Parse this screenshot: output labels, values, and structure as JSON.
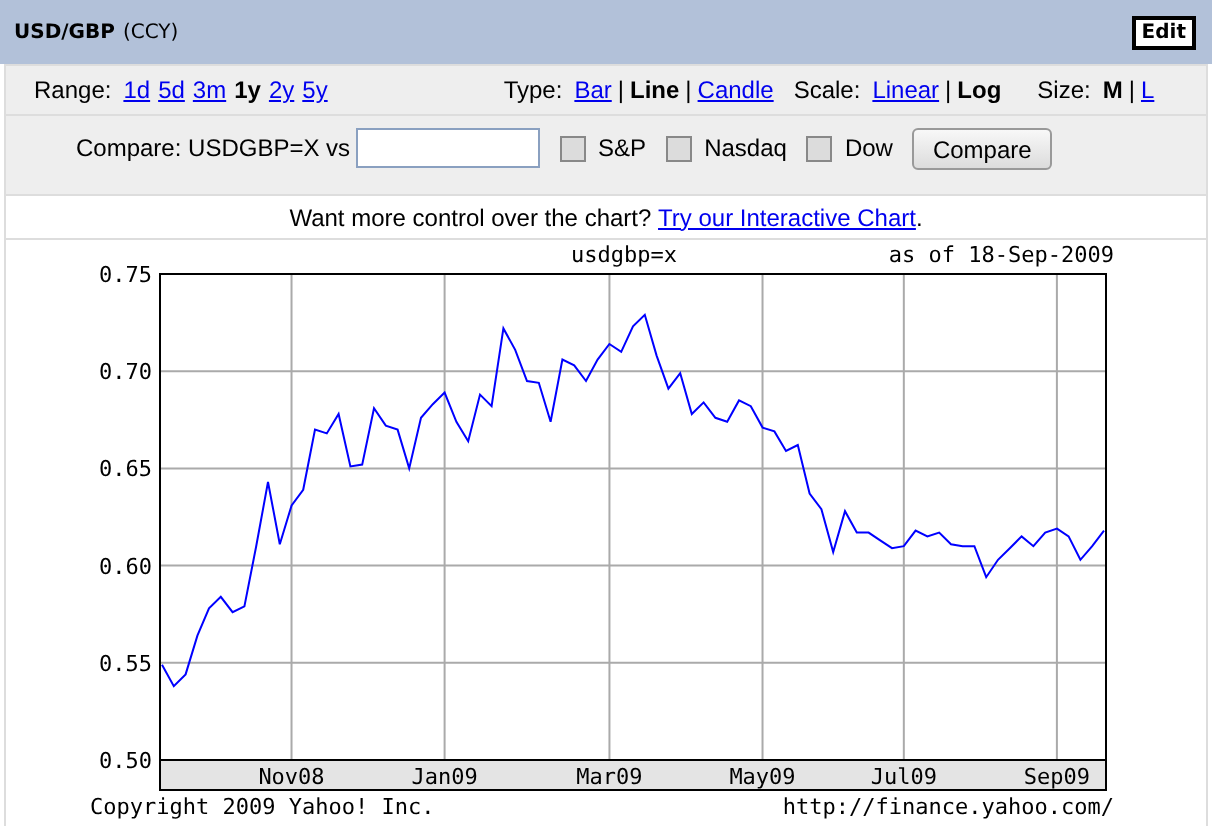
{
  "header": {
    "symbol": "USD/GBP",
    "type": "(CCY)",
    "edit_button": "Edit"
  },
  "range": {
    "label": "Range:",
    "options": [
      {
        "label": "1d",
        "selected": false
      },
      {
        "label": "5d",
        "selected": false
      },
      {
        "label": "3m",
        "selected": false
      },
      {
        "label": "1y",
        "selected": true
      },
      {
        "label": "2y",
        "selected": false
      },
      {
        "label": "5y",
        "selected": false
      }
    ]
  },
  "type": {
    "label": "Type:",
    "separators": [
      "|",
      "|"
    ],
    "options": [
      {
        "label": "Bar",
        "selected": false
      },
      {
        "label": "Line",
        "selected": true
      },
      {
        "label": "Candle",
        "selected": false
      }
    ]
  },
  "scale": {
    "label": "Scale:",
    "separators": [
      "|"
    ],
    "options": [
      {
        "label": "Linear",
        "selected": false
      },
      {
        "label": "Log",
        "selected": true
      }
    ]
  },
  "size": {
    "label": "Size:",
    "separators": [
      "|"
    ],
    "options": [
      {
        "label": "M",
        "selected": true
      },
      {
        "label": "L",
        "selected": false
      }
    ]
  },
  "compare": {
    "label": "Compare: USDGBP=X vs",
    "checkboxes": [
      {
        "label": "S&P",
        "checked": false
      },
      {
        "label": "Nasdaq",
        "checked": false
      },
      {
        "label": "Dow",
        "checked": false
      }
    ],
    "button": "Compare"
  },
  "promo": {
    "text": "Want more control over the chart?",
    "link": "Try our Interactive Chart",
    "suffix": "."
  },
  "chart": {
    "as_of": "as of 18-Sep-2009",
    "copyright": "Copyright 2009 Yahoo! Inc.",
    "url": "http://finance.yahoo.com/",
    "chart_data": {
      "type": "line",
      "title": "usdgbp=x",
      "grid": true,
      "ylim": [
        0.5,
        0.75
      ],
      "yticks": [
        {
          "value": 0.5,
          "label": "0.50"
        },
        {
          "value": 0.55,
          "label": "0.55"
        },
        {
          "value": 0.6,
          "label": "0.60"
        },
        {
          "value": 0.65,
          "label": "0.65"
        },
        {
          "value": 0.7,
          "label": "0.70"
        },
        {
          "value": 0.75,
          "label": "0.75"
        }
      ],
      "categories": [
        null,
        null,
        null,
        null,
        null,
        null,
        null,
        null,
        null,
        null,
        null,
        "Nov08",
        null,
        null,
        null,
        null,
        null,
        null,
        null,
        null,
        null,
        null,
        null,
        null,
        "Jan09",
        null,
        null,
        null,
        null,
        null,
        null,
        null,
        null,
        null,
        null,
        null,
        null,
        null,
        "Mar09",
        null,
        null,
        null,
        null,
        null,
        null,
        null,
        null,
        null,
        null,
        null,
        null,
        "May09",
        null,
        null,
        null,
        null,
        null,
        null,
        null,
        null,
        null,
        null,
        null,
        "Jul09",
        null,
        null,
        null,
        null,
        null,
        null,
        null,
        null,
        null,
        null,
        null,
        null,
        "Sep09",
        null,
        null,
        null,
        null
      ],
      "series": [
        {
          "color": "#0000ff",
          "values": [
            0.549,
            0.538,
            0.544,
            0.564,
            0.578,
            0.584,
            0.576,
            0.579,
            0.61,
            0.643,
            0.611,
            0.631,
            0.639,
            0.67,
            0.668,
            0.678,
            0.651,
            0.652,
            0.681,
            0.672,
            0.67,
            0.65,
            0.676,
            0.683,
            0.689,
            0.674,
            0.664,
            0.688,
            0.682,
            0.722,
            0.711,
            0.695,
            0.694,
            0.674,
            0.706,
            0.703,
            0.695,
            0.706,
            0.714,
            0.71,
            0.723,
            0.729,
            0.708,
            0.691,
            0.699,
            0.678,
            0.684,
            0.676,
            0.674,
            0.685,
            0.682,
            0.671,
            0.669,
            0.659,
            0.662,
            0.637,
            0.629,
            0.607,
            0.628,
            0.617,
            0.617,
            0.613,
            0.609,
            0.61,
            0.618,
            0.615,
            0.617,
            0.611,
            0.61,
            0.61,
            0.594,
            0.603,
            0.609,
            0.615,
            0.61,
            0.617,
            0.619,
            0.615,
            0.603,
            0.61,
            0.618
          ]
        }
      ]
    }
  }
}
